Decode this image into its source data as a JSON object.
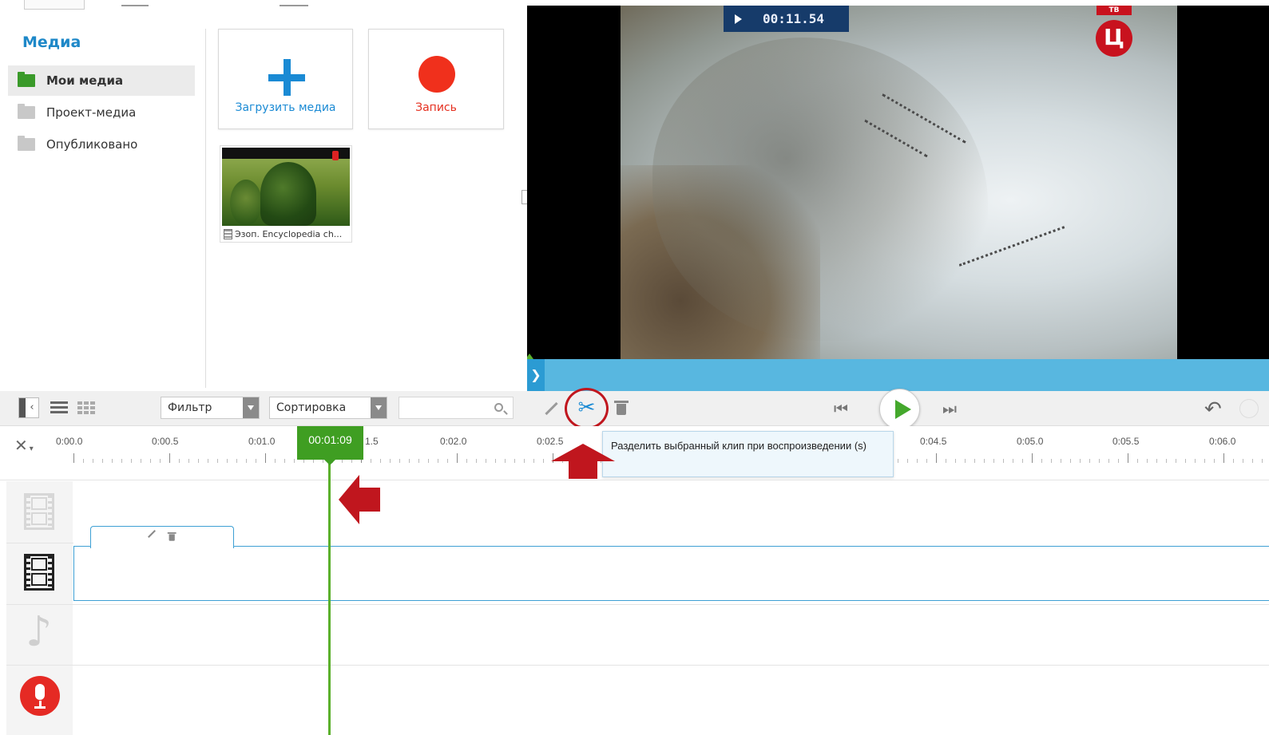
{
  "media": {
    "title": "Медиа",
    "nav": [
      "Мои медиа",
      "Проект-медиа",
      "Опубликовано"
    ],
    "upload_label": "Загрузить медиа",
    "record_label": "Запись",
    "thumb_caption": "Эзоп. Encyclopedia ch..."
  },
  "preview": {
    "timecode": "00:11.54",
    "tv_logo": "Ц",
    "tv_logo_top": "ТВ",
    "progress_chevron": "❯"
  },
  "toolbar": {
    "filter_label": "Фильтр",
    "sort_label": "Сортировка",
    "search_placeholder": "",
    "scissors_glyph": "✂",
    "prev_glyph": "⏮",
    "next_glyph": "⏭",
    "undo_glyph": "↶"
  },
  "timeline": {
    "tools_glyph": "✕",
    "ticks": [
      "0:00.0",
      "0:00.5",
      "0:01.0",
      "",
      "0:02.0",
      "0:02.5",
      "0:04.5",
      "0:05.0",
      "0:05.5",
      "0:06.0"
    ],
    "tick_hidden": "1.5",
    "playhead": "00:01:09",
    "tooltip": "Разделить выбранный клип при воспроизведении (s)"
  },
  "colors": {
    "accent_blue": "#1a8ad4",
    "record_red": "#f0301c",
    "playhead_green": "#3f9e22",
    "annotation_red": "#c0161e"
  }
}
